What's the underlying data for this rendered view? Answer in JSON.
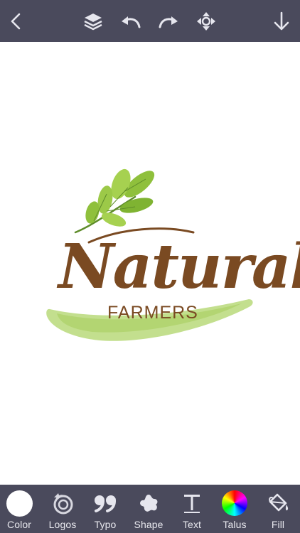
{
  "colors": {
    "toolbar_bg": "#4a4a5c",
    "icon": "#e6e6ee",
    "brand_brown": "#7a4a22",
    "leaf_green": "#8fc03c",
    "brush_green": "#b9d97a"
  },
  "top_toolbar": {
    "icons": [
      "back-icon",
      "layers-icon",
      "undo-icon",
      "redo-icon",
      "move-icon",
      "download-icon"
    ]
  },
  "canvas": {
    "logo": {
      "script_word": "Natural",
      "subtitle": "FARMERS"
    }
  },
  "bottom_toolbar": {
    "items": [
      {
        "label": "Color",
        "icon": "color-swatch-icon"
      },
      {
        "label": "Logos",
        "icon": "logos-icon"
      },
      {
        "label": "Typo",
        "icon": "quote-icon"
      },
      {
        "label": "Shape",
        "icon": "shape-icon"
      },
      {
        "label": "Text",
        "icon": "text-icon"
      },
      {
        "label": "Talus",
        "icon": "color-wheel-icon"
      },
      {
        "label": "Fill",
        "icon": "paint-bucket-icon"
      }
    ]
  }
}
